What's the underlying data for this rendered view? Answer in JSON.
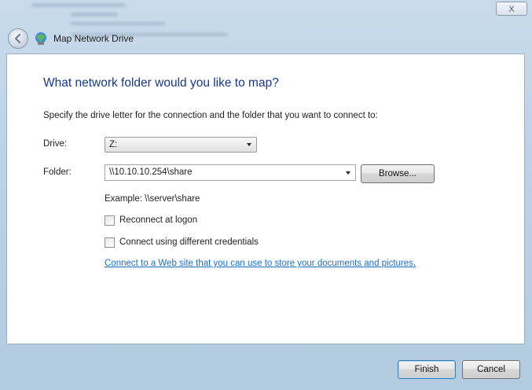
{
  "window": {
    "title": "Map Network Drive",
    "close_label": "X"
  },
  "wizard": {
    "heading": "What network folder would you like to map?",
    "instructions": "Specify the drive letter for the connection and the folder that you want to connect to:"
  },
  "drive": {
    "label": "Drive:",
    "value": "Z:"
  },
  "folder": {
    "label": "Folder:",
    "value": "\\\\10.10.10.254\\share",
    "browse_label": "Browse...",
    "example": "Example: \\\\server\\share"
  },
  "options": {
    "reconnect_label": "Reconnect at logon",
    "reconnect_checked": false,
    "credentials_label": "Connect using different credentials",
    "credentials_checked": false
  },
  "link": {
    "text": "Connect to a Web site that you can use to store your documents and pictures",
    "trailing": "."
  },
  "footer": {
    "finish_label": "Finish",
    "cancel_label": "Cancel"
  },
  "colors": {
    "heading": "#14388a",
    "link": "#1a6fc2",
    "frame": "#bcd2e6"
  },
  "icons": {
    "back": "back-arrow-icon",
    "app": "network-drive-icon",
    "close": "close-icon"
  }
}
